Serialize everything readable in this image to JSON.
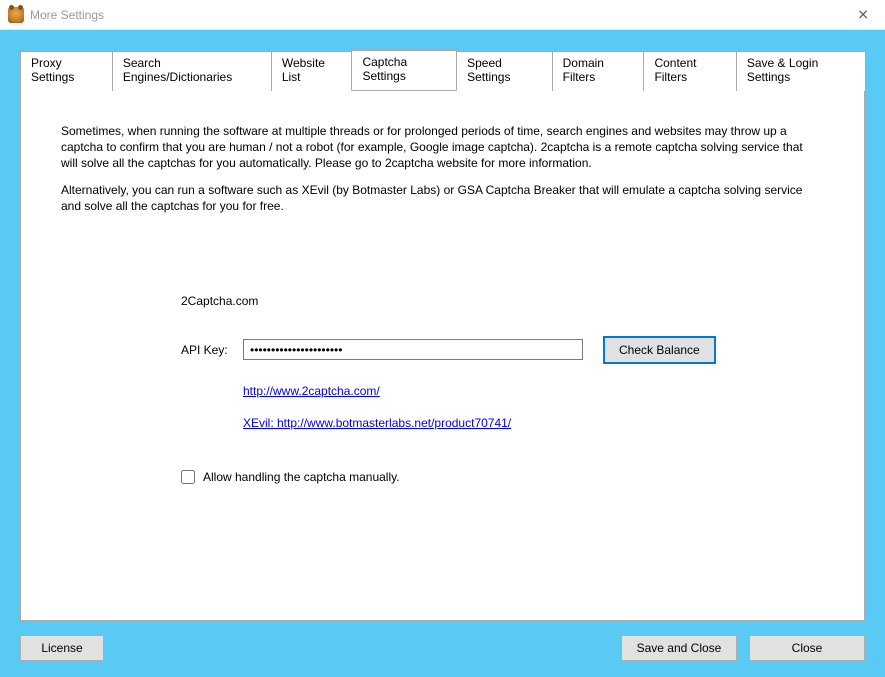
{
  "window": {
    "title": "More Settings"
  },
  "tabs": [
    {
      "label": "Proxy Settings"
    },
    {
      "label": "Search Engines/Dictionaries"
    },
    {
      "label": "Website List"
    },
    {
      "label": "Captcha Settings"
    },
    {
      "label": "Speed Settings"
    },
    {
      "label": "Domain Filters"
    },
    {
      "label": "Content Filters"
    },
    {
      "label": "Save & Login Settings"
    }
  ],
  "active_tab_index": 3,
  "content": {
    "intro_p1": "Sometimes, when running the software at multiple threads or for prolonged periods of time, search engines and websites may throw up a captcha to confirm that you are human / not a robot (for example, Google image captcha). 2captcha is a remote captcha solving service that will solve all the captchas for you automatically. Please go to 2captcha website for more information.",
    "intro_p2": "Alternatively, you can run a software such as XEvil (by Botmaster Labs) or GSA Captcha Breaker that will emulate a captcha solving service and solve all the captchas for you for free.",
    "section_title": "2Captcha.com",
    "api_key_label": "API Key:",
    "api_key_value": "••••••••••••••••••••••",
    "check_balance_label": "Check Balance",
    "link1": "http://www.2captcha.com/",
    "link2": "XEvil: http://www.botmasterlabs.net/product70741/",
    "checkbox_label": "Allow handling the captcha manually.",
    "checkbox_checked": false
  },
  "buttons": {
    "license": "License",
    "save_close": "Save and Close",
    "close": "Close"
  }
}
